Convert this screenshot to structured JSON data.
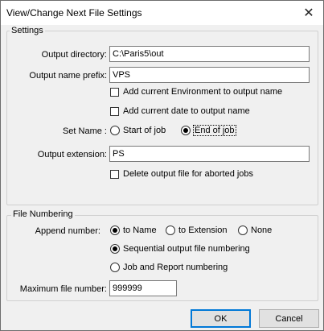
{
  "window": {
    "title": "View/Change Next File Settings",
    "close_glyph": "✕"
  },
  "settings": {
    "legend": "Settings",
    "output_directory": {
      "label": "Output directory:",
      "value": "C:\\Paris5\\out"
    },
    "output_name_prefix": {
      "label": "Output name prefix:",
      "value": "VPS"
    },
    "add_environment": {
      "label": "Add current Environment to output name",
      "checked": false
    },
    "add_date": {
      "label": "Add current date to output name",
      "checked": false
    },
    "set_name": {
      "label": "Set Name :",
      "options": [
        {
          "label": "Start of job",
          "selected": false
        },
        {
          "label": "End of job",
          "selected": true
        }
      ]
    },
    "output_extension": {
      "label": "Output extension:",
      "value": "PS"
    },
    "delete_output": {
      "label": "Delete output file for aborted jobs",
      "checked": false
    }
  },
  "file_numbering": {
    "legend": "File Numbering",
    "append_number_label": "Append number:",
    "append_options": [
      {
        "label": "to Name",
        "selected": true
      },
      {
        "label": "to Extension",
        "selected": false
      },
      {
        "label": "None",
        "selected": false
      }
    ],
    "numbering_options": [
      {
        "label": "Sequential output file numbering",
        "selected": true
      },
      {
        "label": "Job and Report numbering",
        "selected": false
      }
    ],
    "max_file_number": {
      "label": "Maximum file number:",
      "value": "999999"
    }
  },
  "buttons": {
    "ok": "OK",
    "cancel": "Cancel"
  }
}
